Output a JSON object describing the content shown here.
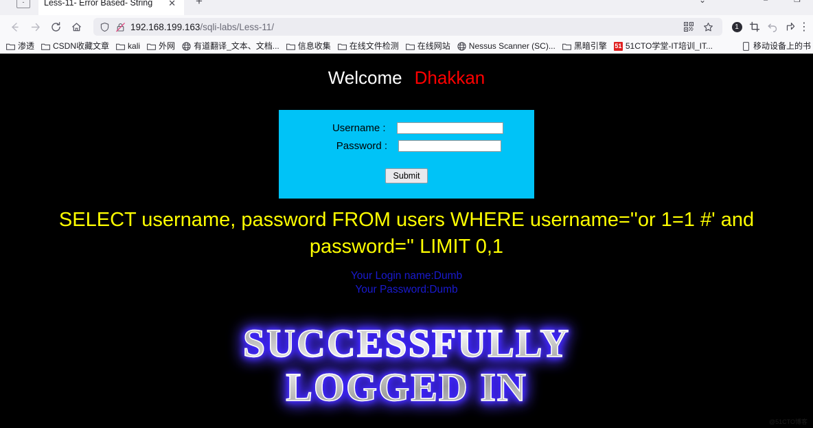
{
  "window": {
    "minimize_glyph": "–",
    "restore_glyph": "❐",
    "chevron_glyph": "⌄",
    "tab_list_glyph": "-"
  },
  "tab": {
    "title": "Less-11- Error Based- String",
    "close_glyph": "✕",
    "new_tab_glyph": "+"
  },
  "nav": {
    "back_glyph": "←",
    "forward_glyph": "→",
    "reload_glyph": "⟳",
    "home_glyph": "⌂",
    "url_host": "192.168.199.163",
    "url_path": "/sqli-labs/Less-11/",
    "shield_title": "shield",
    "lock_broken_title": "insecure-connection",
    "qr_glyph": "▦",
    "star_glyph": "☆",
    "notification_count": "1",
    "screenshot_glyph": "⛶",
    "undo_glyph": "↶",
    "share_glyph": "↗",
    "menu_glyph": "⋮"
  },
  "bookmarks": [
    {
      "label": "渗透",
      "icon": "folder-icon"
    },
    {
      "label": "CSDN收藏文章",
      "icon": "folder-icon"
    },
    {
      "label": "kali",
      "icon": "folder-icon"
    },
    {
      "label": "外网",
      "icon": "folder-icon"
    },
    {
      "label": "有道翻译_文本、文档...",
      "icon": "globe-icon"
    },
    {
      "label": "信息收集",
      "icon": "folder-icon"
    },
    {
      "label": "在线文件检测",
      "icon": "folder-icon"
    },
    {
      "label": "在线网站",
      "icon": "folder-icon"
    },
    {
      "label": "Nessus Scanner (SC)...",
      "icon": "globe-icon"
    },
    {
      "label": "黑暗引擎",
      "icon": "folder-icon"
    },
    {
      "label": "51CTO学堂-IT培训_IT...",
      "icon": "favicon-51cto"
    }
  ],
  "bookmarks_overflow": {
    "label": "移动设备上的书",
    "icon": "mobile-icon"
  },
  "page": {
    "welcome_text": "Welcome",
    "brand_text": "Dhakkan",
    "form": {
      "username_label": "Username :",
      "password_label": "Password :",
      "username_value": "",
      "password_value": "",
      "submit_label": "Submit",
      "box_color": "#00c3f7"
    },
    "sql_query": "SELECT username, password FROM users WHERE username=''or 1=1 #' and password='' LIMIT 0,1",
    "login_name_line": "Your Login name:Dumb",
    "password_line": "Your Password:Dumb",
    "success_line1": "SUCCESSFULLY",
    "success_line2": "LOGGED IN",
    "watermark": "@51CTO博客",
    "colors": {
      "sql_text": "#ffff00",
      "brand": "#ff0000",
      "creds": "#1a1ad0",
      "background": "#000000"
    }
  }
}
